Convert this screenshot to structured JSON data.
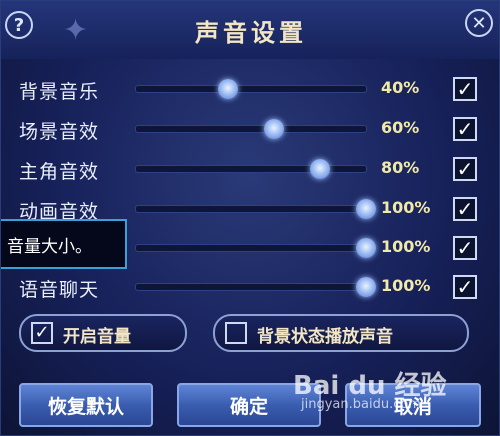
{
  "window": {
    "title": "声音设置"
  },
  "controls": {
    "help_symbol": "?",
    "close_symbol": "✕"
  },
  "rows": [
    {
      "label": "背景音乐",
      "value_text": "40%",
      "level": 0.4,
      "checked": true
    },
    {
      "label": "场景音效",
      "value_text": "60%",
      "level": 0.6,
      "checked": true
    },
    {
      "label": "主角音效",
      "value_text": "80%",
      "level": 0.8,
      "checked": true
    },
    {
      "label": "动画音效",
      "value_text": "100%",
      "level": 1.0,
      "checked": true
    },
    {
      "label": "",
      "value_text": "100%",
      "level": 1.0,
      "checked": true
    },
    {
      "label": "语音聊天",
      "value_text": "100%",
      "level": 1.0,
      "checked": true
    }
  ],
  "tooltip": {
    "text": "音量大小。"
  },
  "toggles": {
    "enable_volume": {
      "label": "开启音量",
      "checked": true
    },
    "background_sound": {
      "label": "背景状态播放声音",
      "checked": false
    }
  },
  "buttons": {
    "reset": "恢复默认",
    "ok": "确定",
    "cancel": "取消"
  },
  "checkmark": "✓",
  "watermark": {
    "brand": "Bai du 经验",
    "url": "jingyan.baidu.com"
  },
  "colors": {
    "accent_text": "#f1e9a8",
    "title_text": "#f3e6c4",
    "button_blue": "#3a5db0"
  }
}
